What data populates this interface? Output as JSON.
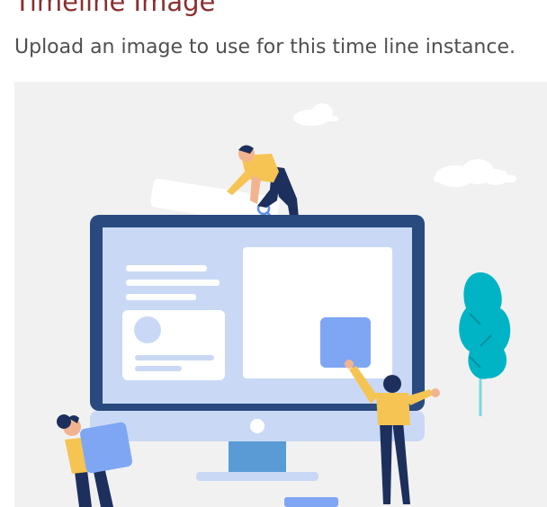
{
  "section": {
    "title": "Timeline Image",
    "description": "Upload an image to use for this time line instance."
  },
  "image": {
    "illustration": "computer-upload-illustration",
    "colors": {
      "background": "#f1f1f1",
      "monitor_frame": "#284a7f",
      "screen": "#c9d9f5",
      "card": "#ffffff",
      "accent_tile": "#7ea6f3",
      "skin": "#f2b48f",
      "shirt": "#f6c453",
      "pants": "#1d2f5c",
      "tree": "#00b4c5",
      "cloud": "#ffffff",
      "stand": "#5a9bd5"
    }
  }
}
